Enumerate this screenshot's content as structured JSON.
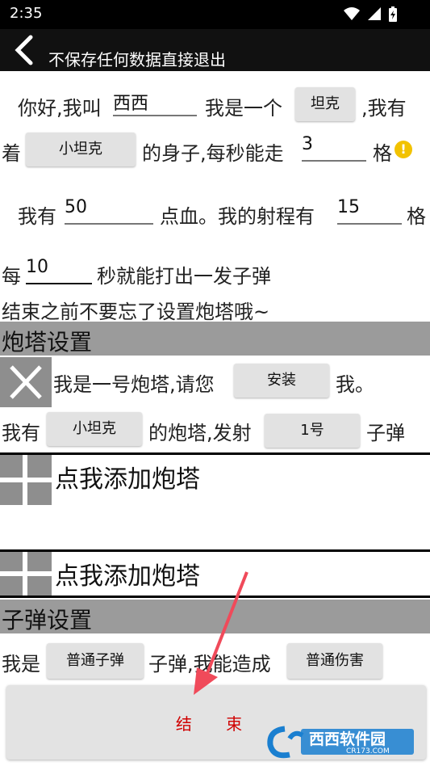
{
  "status": {
    "time": "2:35"
  },
  "titlebar": {
    "title": "不保存任何数据直接退出"
  },
  "intro": {
    "t_hello": "你好,我叫",
    "name_value": "西西",
    "t_iam": "我是一个",
    "type_button": "坦克",
    "t_ihave": ",我有",
    "t_zhe": "着",
    "body_button": "小坦克",
    "t_body": "的身子,每秒能走",
    "speed_value": "3",
    "t_grid": "格",
    "t_woyou": "我有",
    "hp_value": "50",
    "t_hp": "点血。我的射程有",
    "range_value": "15",
    "t_grid2": "格",
    "t_every": "每",
    "interval_value": "10",
    "t_fire": "秒就能打出一发子弹",
    "reminder": "结束之前不要忘了设置炮塔哦~"
  },
  "turret_section": {
    "title": "炮塔设置",
    "turret1": {
      "t_prefix": "我是一号炮塔,请您",
      "install_button": "安装",
      "t_me": "我。",
      "t_have": "我有",
      "turret_button": "小坦克",
      "t_fires": "的炮塔,发射",
      "ammo_button": "1号",
      "t_bullet": "子弹"
    },
    "add_label_1": "点我添加炮塔",
    "add_label_2": "点我添加炮塔"
  },
  "bullet_section": {
    "title": "子弹设置",
    "t_iam": "我是",
    "bullet_button": "普通子弹",
    "t_damage": "子弹,我能造成",
    "damage_button": "普通伤害"
  },
  "end_button": "结 束",
  "watermark": {
    "brand": "西西软件园",
    "domain": "CR173.COM"
  },
  "colors": {
    "header": "#111111",
    "section": "#9b9b9b",
    "end_text": "#d00000",
    "arrow": "#f04a5a"
  }
}
